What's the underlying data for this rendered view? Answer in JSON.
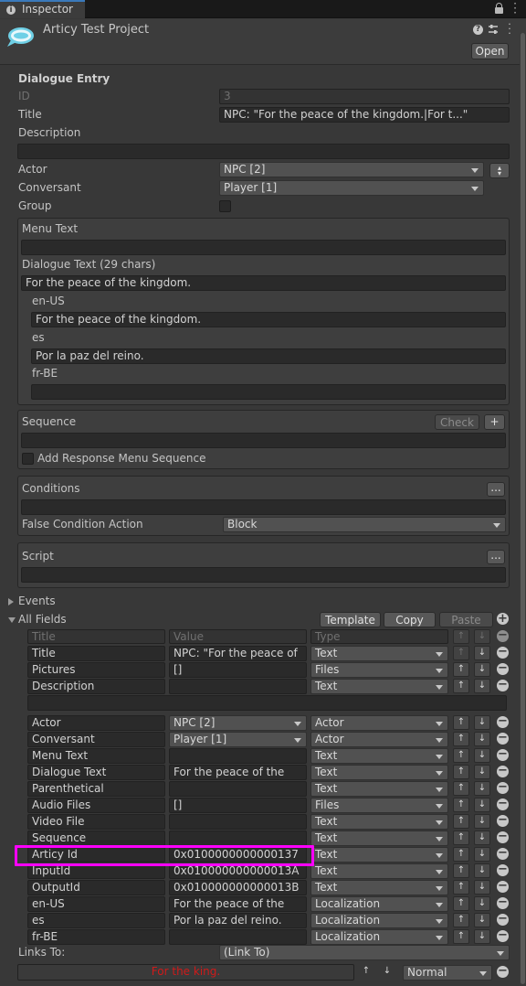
{
  "tab": {
    "title": "Inspector"
  },
  "header": {
    "title": "Articy Test Project",
    "open_label": "Open"
  },
  "entry": {
    "section_title": "Dialogue Entry",
    "id_label": "ID",
    "id_value": "3",
    "title_label": "Title",
    "title_value": "NPC: \"For the peace of the kingdom.|For t...\"",
    "description_label": "Description",
    "description_value": "",
    "actor_label": "Actor",
    "actor_value": "NPC [2]",
    "conversant_label": "Conversant",
    "conversant_value": "Player [1]",
    "group_label": "Group"
  },
  "text_box": {
    "menu_text_label": "Menu Text",
    "menu_text_value": "",
    "dialogue_text_label": "Dialogue Text (29 chars)",
    "dialogue_text_value": "For the peace of the kingdom.",
    "locales": [
      {
        "code": "en-US",
        "value": "For the peace of the kingdom."
      },
      {
        "code": "es",
        "value": "Por la paz del reino."
      },
      {
        "code": "fr-BE",
        "value": ""
      }
    ]
  },
  "sequence": {
    "label": "Sequence",
    "check_label": "Check",
    "add_label": "+",
    "add_response_label": "Add Response Menu Sequence"
  },
  "conditions": {
    "label": "Conditions",
    "more_label": "...",
    "false_action_label": "False Condition Action",
    "false_action_value": "Block"
  },
  "script": {
    "label": "Script",
    "more_label": "..."
  },
  "events": {
    "label": "Events"
  },
  "all_fields": {
    "label": "All Fields",
    "template_label": "Template",
    "copy_label": "Copy",
    "paste_label": "Paste",
    "col_title": "Title",
    "col_value": "Value",
    "col_type": "Type",
    "rows_top": [
      {
        "title": "Title",
        "value": "NPC: \"For the peace of",
        "type": "Text"
      },
      {
        "title": "Pictures",
        "value": "[]",
        "type": "Files"
      },
      {
        "title": "Description",
        "value": "",
        "type": "Text"
      }
    ],
    "rows": [
      {
        "title": "Actor",
        "value": "NPC [2]",
        "type": "Actor",
        "value_drop": true
      },
      {
        "title": "Conversant",
        "value": "Player [1]",
        "type": "Actor",
        "value_drop": true
      },
      {
        "title": "Menu Text",
        "value": "",
        "type": "Text"
      },
      {
        "title": "Dialogue Text",
        "value": "For the peace of the",
        "type": "Text"
      },
      {
        "title": "Parenthetical",
        "value": "",
        "type": "Text"
      },
      {
        "title": "Audio Files",
        "value": "[]",
        "type": "Files"
      },
      {
        "title": "Video File",
        "value": "",
        "type": "Text"
      },
      {
        "title": "Sequence",
        "value": "",
        "type": "Text"
      },
      {
        "title": "Articy Id",
        "value": "0x0100000000000137",
        "type": "Text"
      },
      {
        "title": "InputId",
        "value": "0x010000000000013A",
        "type": "Text"
      },
      {
        "title": "OutputId",
        "value": "0x010000000000013B",
        "type": "Text"
      },
      {
        "title": "en-US",
        "value": "For the peace of the",
        "type": "Localization"
      },
      {
        "title": "es",
        "value": "Por la paz del reino.",
        "type": "Localization"
      },
      {
        "title": "fr-BE",
        "value": "",
        "type": "Localization"
      }
    ]
  },
  "links": {
    "label": "Links To:",
    "value": "(Link To)",
    "link_text": "For the king.",
    "priority": "Normal"
  }
}
